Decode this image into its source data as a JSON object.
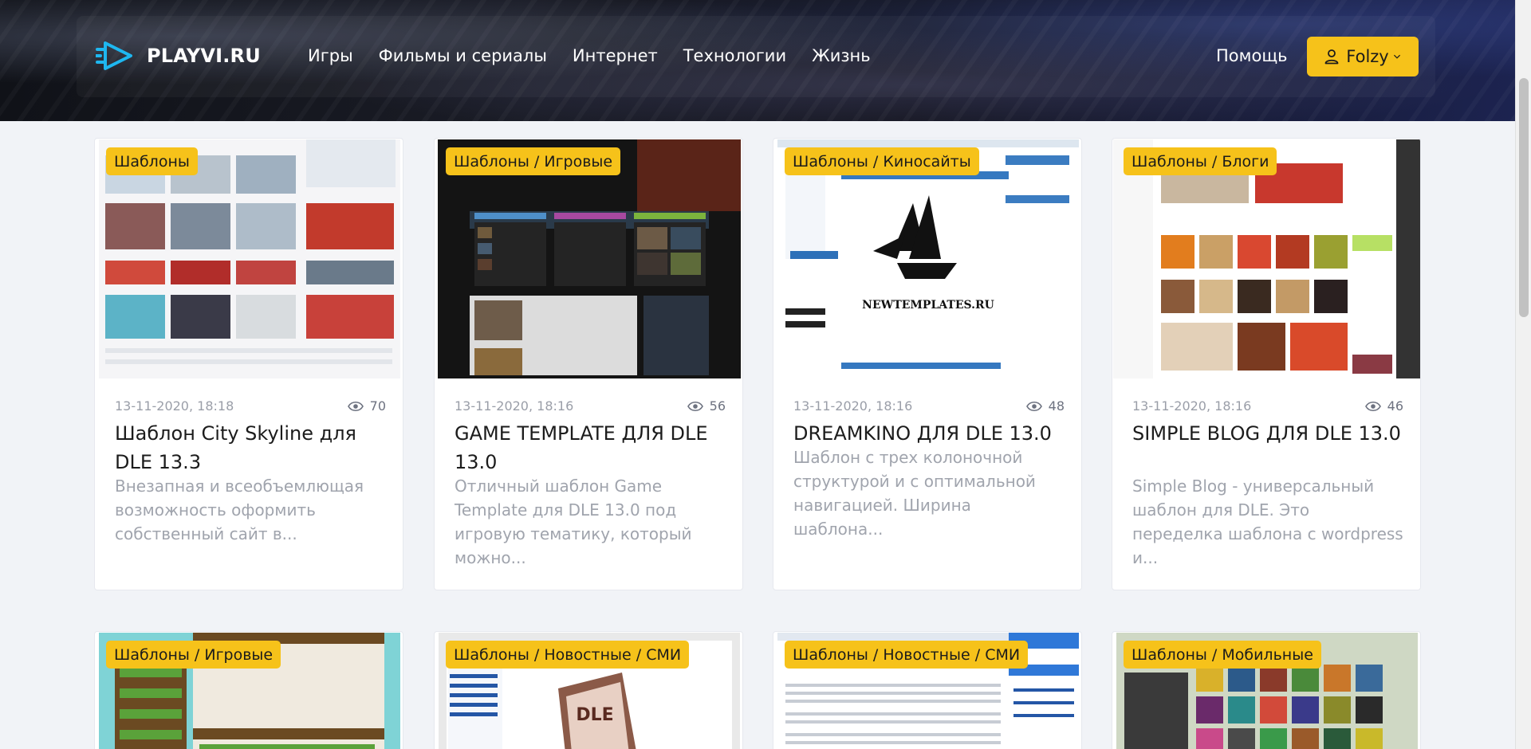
{
  "header": {
    "logo": "PLAYVI.RU",
    "menu": [
      "Игры",
      "Фильмы и сериалы",
      "Интернет",
      "Технологии",
      "Жизнь"
    ],
    "help": "Помощь",
    "user": "Folzy",
    "accent": "#f6c21a"
  },
  "cards": [
    {
      "category": "Шаблоны",
      "date": "13-11-2020, 18:18",
      "views": "70",
      "title": "Шаблон City Skyline для DLE 13.3",
      "desc": "Внезапная и всеобъемлющая возможность оформить собственный сайт в..."
    },
    {
      "category": "Шаблоны / Игровые",
      "date": "13-11-2020, 18:16",
      "views": "56",
      "title": "GAME TEMPLATE ДЛЯ DLE 13.0",
      "desc": "Отличный шаблон Game Template для DLE 13.0 под игровую тематику, который можно..."
    },
    {
      "category": "Шаблоны / Киносайты",
      "date": "13-11-2020, 18:16",
      "views": "48",
      "title": "DREAMKINO ДЛЯ DLE 13.0",
      "desc": "Шаблон с трех колоночной структурой и с оптимальной навигацией. Ширина шаблона..."
    },
    {
      "category": "Шаблоны / Блоги",
      "date": "13-11-2020, 18:16",
      "views": "46",
      "title": "SIMPLE BLOG ДЛЯ DLE 13.0",
      "desc": "Simple Blog - универсальный шаблон для DLE. Это переделка шаблона с wordpress и..."
    },
    {
      "category": "Шаблоны / Игровые"
    },
    {
      "category": "Шаблоны / Новостные / СМИ"
    },
    {
      "category": "Шаблоны / Новостные / СМИ"
    },
    {
      "category": "Шаблоны / Мобильные"
    }
  ],
  "thumb_text": {
    "newtemplates": "NEWTEMPLATES.RU",
    "dle": "DLE"
  }
}
